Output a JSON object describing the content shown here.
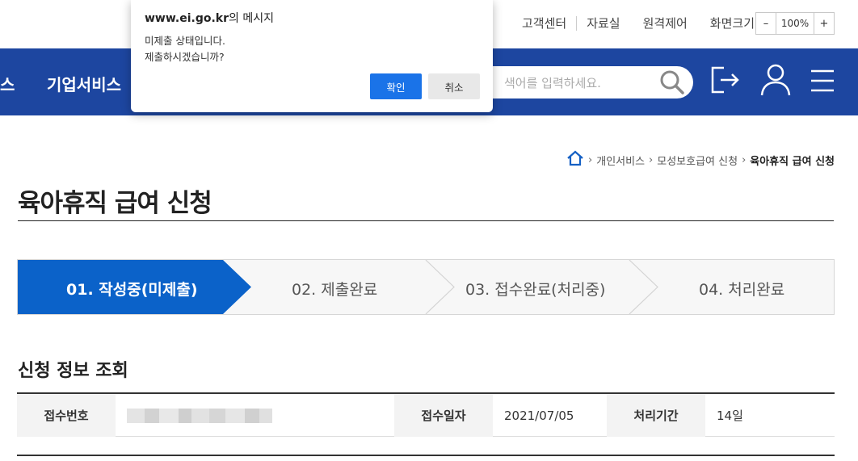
{
  "util": {
    "links": [
      "고객센터",
      "자료실",
      "원격제어",
      "화면크기"
    ],
    "zoom_minus": "–",
    "zoom_value": "100%",
    "zoom_plus": "+"
  },
  "nav": {
    "items": [
      "스",
      "기업서비스"
    ],
    "search_placeholder": "색어를 입력하세요."
  },
  "breadcrumb": {
    "items": [
      "개인서비스",
      "모성보호급여 신청"
    ],
    "current": "육아휴직 급여 신청"
  },
  "page_title": "육아휴직 급여 신청",
  "steps": [
    {
      "label": "01. 작성중(미제출)",
      "active": true
    },
    {
      "label": "02. 제출완료",
      "active": false
    },
    {
      "label": "03. 접수완료(처리중)",
      "active": false
    },
    {
      "label": "04. 처리완료",
      "active": false
    }
  ],
  "section_title": "신청 정보 조회",
  "info": {
    "receipt_no_label": "접수번호",
    "receipt_date_label": "접수일자",
    "receipt_date": "2021/07/05",
    "period_label": "처리기간",
    "period": "14일"
  },
  "dialog": {
    "site": "www.ei.go.kr",
    "title_suffix": "의 메시지",
    "line1": "미제출 상태입니다.",
    "line2": "제출하시겠습니까?",
    "ok_label": "확인",
    "cancel_label": "취소"
  },
  "colors": {
    "nav_blue": "#1d46a0",
    "step_active": "#0b62c9",
    "dialog_ok": "#1a73e8"
  }
}
